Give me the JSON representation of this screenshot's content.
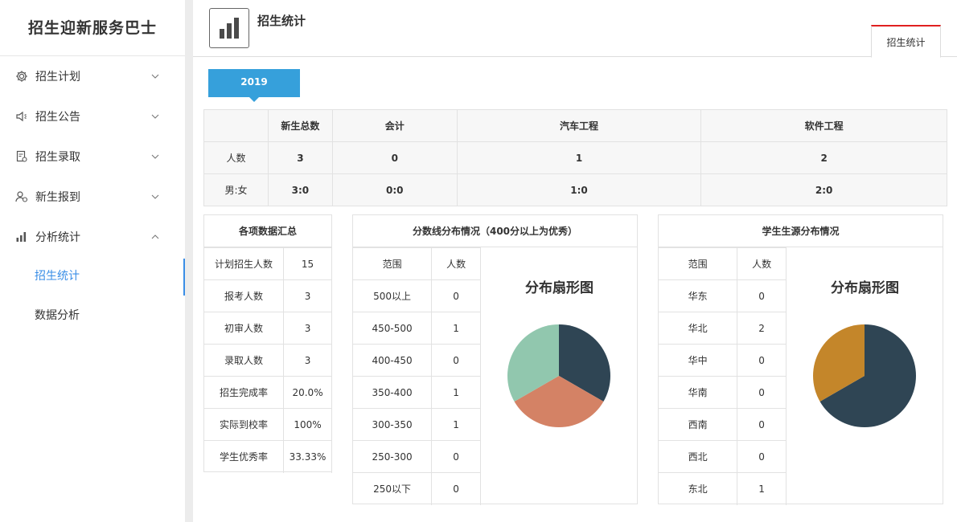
{
  "sidebar": {
    "brand": "招生迎新服务巴士",
    "items": [
      {
        "label": "招生计划",
        "icon": "gear-icon"
      },
      {
        "label": "招生公告",
        "icon": "speaker-icon"
      },
      {
        "label": "招生录取",
        "icon": "document-icon"
      },
      {
        "label": "新生报到",
        "icon": "users-icon"
      },
      {
        "label": "分析统计",
        "icon": "bar-chart-icon"
      }
    ],
    "subitems": [
      {
        "label": "招生统计"
      },
      {
        "label": "数据分析"
      }
    ]
  },
  "header": {
    "title": "招生统计",
    "tab": "招生统计"
  },
  "year": "2019",
  "stats": {
    "headers": [
      "",
      "新生总数",
      "会计",
      "汽车工程",
      "软件工程"
    ],
    "rows": [
      [
        "人数",
        "3",
        "0",
        "1",
        "2"
      ],
      [
        "男:女",
        "3:0",
        "0:0",
        "1:0",
        "2:0"
      ]
    ]
  },
  "summary": {
    "title": "各项数据汇总",
    "rows": [
      [
        "计划招生人数",
        "15"
      ],
      [
        "报考人数",
        "3"
      ],
      [
        "初审人数",
        "3"
      ],
      [
        "录取人数",
        "3"
      ],
      [
        "招生完成率",
        "20.0%"
      ],
      [
        "实际到校率",
        "100%"
      ],
      [
        "学生优秀率",
        "33.33%"
      ]
    ]
  },
  "scores": {
    "title": "分数线分布情况（400分以上为优秀）",
    "headers": [
      "范围",
      "人数"
    ],
    "rows": [
      [
        "500以上",
        "0"
      ],
      [
        "450-500",
        "1"
      ],
      [
        "400-450",
        "0"
      ],
      [
        "350-400",
        "1"
      ],
      [
        "300-350",
        "1"
      ],
      [
        "250-300",
        "0"
      ],
      [
        "250以下",
        "0"
      ]
    ],
    "pie_title": "分布扇形图"
  },
  "regions": {
    "title": "学生生源分布情况",
    "headers": [
      "范围",
      "人数"
    ],
    "rows": [
      [
        "华东",
        "0"
      ],
      [
        "华北",
        "2"
      ],
      [
        "华中",
        "0"
      ],
      [
        "华南",
        "0"
      ],
      [
        "西南",
        "0"
      ],
      [
        "西北",
        "0"
      ],
      [
        "东北",
        "1"
      ]
    ],
    "pie_title": "分布扇形图"
  },
  "chart_data": [
    {
      "type": "pie",
      "categories": [
        "450-500",
        "350-400",
        "300-350"
      ],
      "values": [
        1,
        1,
        1
      ],
      "colors": [
        "#2f4554",
        "#d48265",
        "#91c7ae"
      ]
    },
    {
      "type": "pie",
      "categories": [
        "华北",
        "东北"
      ],
      "values": [
        2,
        1
      ],
      "colors": [
        "#2f4554",
        "#c4862a"
      ]
    }
  ]
}
